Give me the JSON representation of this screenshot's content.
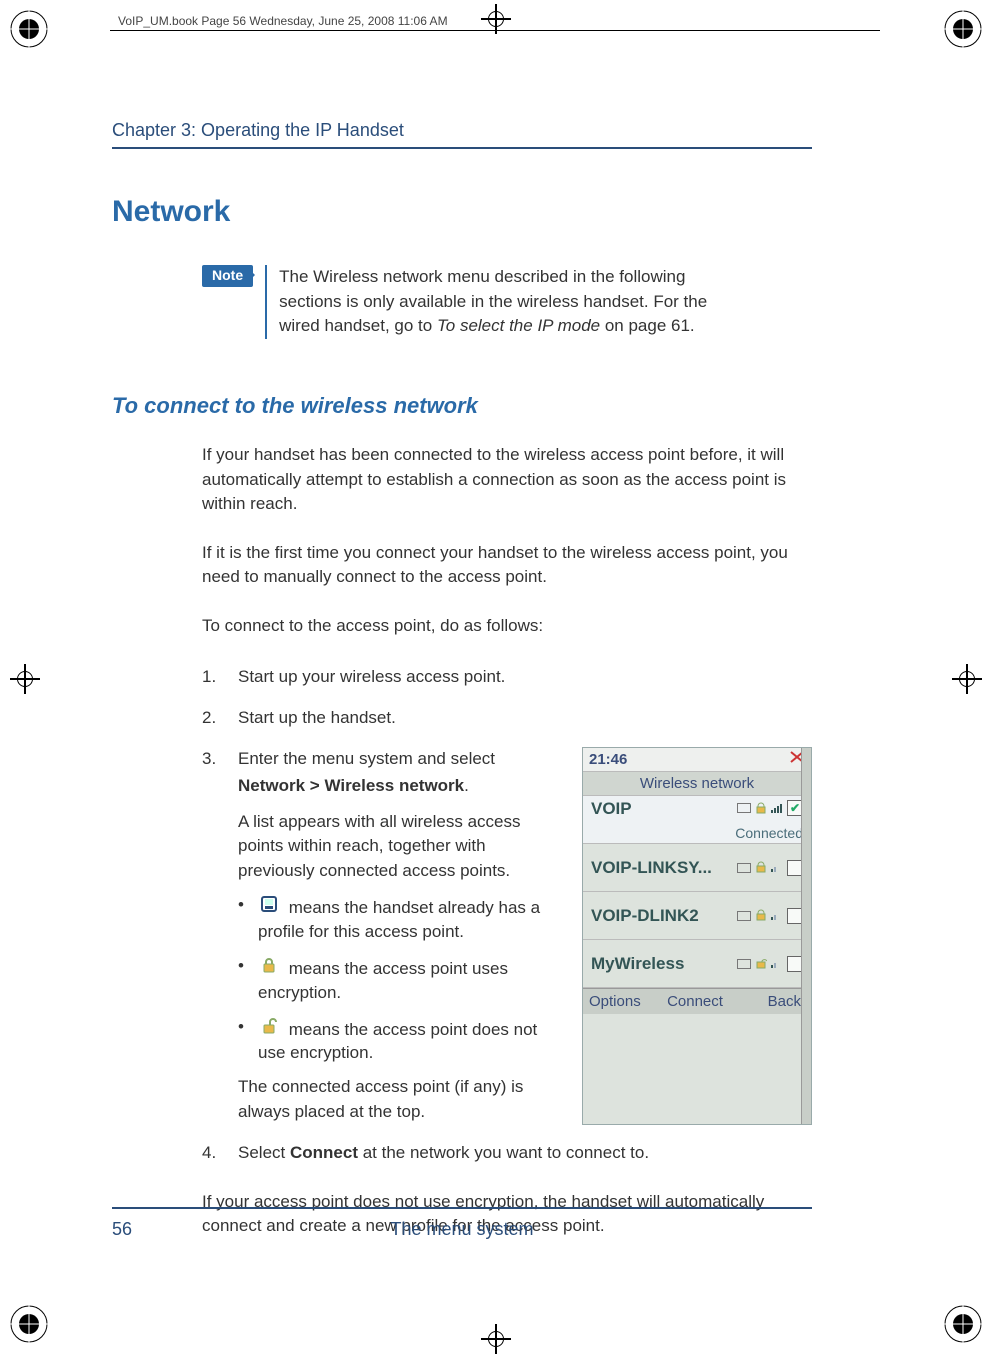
{
  "spec_header": "VoIP_UM.book  Page 56  Wednesday, June 25, 2008  11:06 AM",
  "chapter_header": "Chapter 3:  Operating the IP Handset",
  "section_title": "Network",
  "note_label": "Note",
  "note_text_1": "The Wireless network menu described in the following sections is only available in the wireless handset. For the wired handset, go to ",
  "note_link": "To select the IP mode",
  "note_text_2": " on page 61.",
  "subhead": "To connect to the wireless network",
  "para1": "If your handset has been connected to the wireless access point before, it will automatically attempt to establish a connection as soon as the access point is within reach.",
  "para2": "If it is the first time you connect your handset to the wireless access point, you need to manually connect to the access point.",
  "para3": "To connect to the access point, do as follows:",
  "steps": {
    "s1": "Start up your wireless access point.",
    "s2": "Start up the handset.",
    "s3_a": "Enter the menu system and select ",
    "s3_bold": "Network > Wireless network",
    "s3_b": ".",
    "s3_sub": "A list appears with all wireless access points within reach, together with previously connected access points.",
    "s3_bul1": " means the handset already has a profile for this access point.",
    "s3_bul2": " means the access point uses encryption.",
    "s3_bul3": " means the access point does not use encryption.",
    "s3_tail": "The connected access point (if any) is always placed at the top.",
    "s4_a": "Select ",
    "s4_bold": "Connect",
    "s4_b": " at the network you want to connect to."
  },
  "para4": "If your access point does not use encryption, the handset will automatically connect and create a new profile for the access point.",
  "footer": {
    "page": "56",
    "title": "The menu system"
  },
  "phone": {
    "time": "21:46",
    "title": "Wireless network",
    "rows": [
      {
        "name": "VOIP",
        "status": "Connected",
        "checked": true,
        "lock": "closed"
      },
      {
        "name": "VOIP-LINKSY...",
        "status": "",
        "checked": false,
        "lock": "closed"
      },
      {
        "name": "VOIP-DLINK2",
        "status": "",
        "checked": false,
        "lock": "closed"
      },
      {
        "name": "MyWireless",
        "status": "",
        "checked": false,
        "lock": "open"
      }
    ],
    "softkeys": {
      "left": "Options",
      "center": "Connect",
      "right": "Back"
    }
  }
}
